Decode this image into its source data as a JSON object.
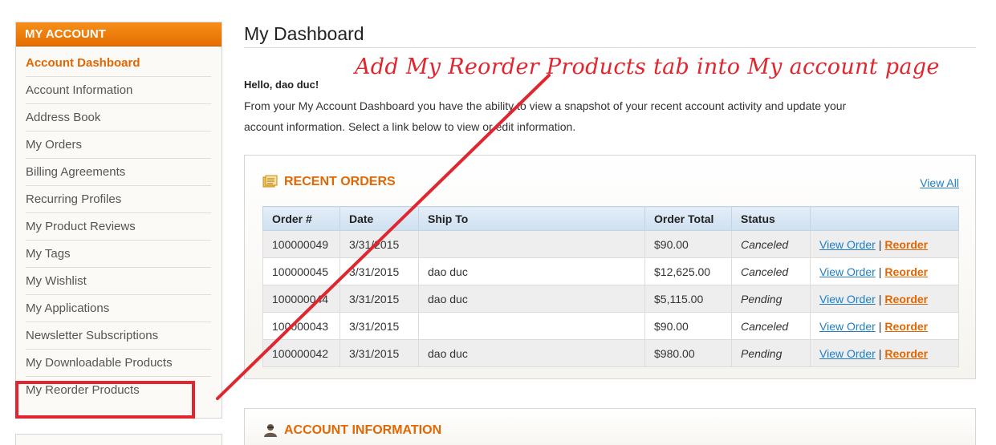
{
  "sidebar": {
    "title": "MY ACCOUNT",
    "items": [
      {
        "label": "Account Dashboard",
        "active": true
      },
      {
        "label": "Account Information"
      },
      {
        "label": "Address Book"
      },
      {
        "label": "My Orders"
      },
      {
        "label": "Billing Agreements"
      },
      {
        "label": "Recurring Profiles"
      },
      {
        "label": "My Product Reviews"
      },
      {
        "label": "My Tags"
      },
      {
        "label": "My Wishlist"
      },
      {
        "label": "My Applications"
      },
      {
        "label": "Newsletter Subscriptions"
      },
      {
        "label": "My Downloadable Products"
      },
      {
        "label": "My Reorder Products"
      }
    ]
  },
  "main": {
    "title": "My Dashboard",
    "hello": "Hello, dao duc!",
    "intro": "From your My Account Dashboard you have the ability to view a snapshot of your recent account activity and update your account information. Select a link below to view or edit information."
  },
  "recent_orders": {
    "title": "RECENT ORDERS",
    "icon": "recent-orders-icon",
    "view_all": "View All",
    "columns": [
      "Order #",
      "Date",
      "Ship To",
      "Order Total",
      "Status",
      ""
    ],
    "rows": [
      {
        "order": "100000049",
        "date": "3/31/2015",
        "ship_to": "",
        "total": "$90.00",
        "status": "Canceled"
      },
      {
        "order": "100000045",
        "date": "3/31/2015",
        "ship_to": "dao duc",
        "total": "$12,625.00",
        "status": "Canceled"
      },
      {
        "order": "100000044",
        "date": "3/31/2015",
        "ship_to": "dao duc",
        "total": "$5,115.00",
        "status": "Pending"
      },
      {
        "order": "100000043",
        "date": "3/31/2015",
        "ship_to": "",
        "total": "$90.00",
        "status": "Canceled"
      },
      {
        "order": "100000042",
        "date": "3/31/2015",
        "ship_to": "dao duc",
        "total": "$980.00",
        "status": "Pending"
      }
    ],
    "view_order_label": "View Order",
    "separator": "|",
    "reorder_label": "Reorder"
  },
  "account_information": {
    "title": "ACCOUNT INFORMATION",
    "icon": "user-icon"
  },
  "annotation": {
    "text": "Add My Reorder Products tab into My account page",
    "color": "#e0262e"
  },
  "colors": {
    "accent": "#e26703",
    "link": "#1e7ec8",
    "header_orange": "#f68f19"
  }
}
